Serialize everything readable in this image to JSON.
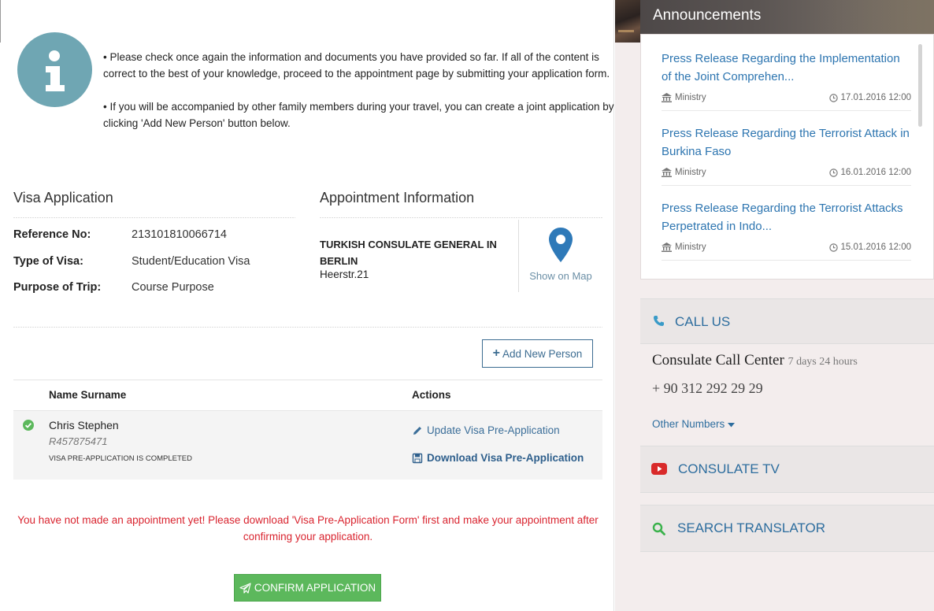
{
  "info": {
    "paragraph1": "• Please check once again the information and documents you have provided so far. If all of the content is correct to the best of your knowledge, proceed to the appointment page by submitting your application form.",
    "paragraph2": "• If you will be accompanied by other family members during your travel, you can create a joint application by clicking 'Add New Person' button below."
  },
  "visa": {
    "title": "Visa Application",
    "reference_label": "Reference No:",
    "reference_value": "213101810066714",
    "type_label": "Type of Visa:",
    "type_value": "Student/Education Visa",
    "purpose_label": "Purpose of Trip:",
    "purpose_value": "Course Purpose"
  },
  "appointment": {
    "title": "Appointment Information",
    "consulate_name": "TURKISH CONSULATE GENERAL IN BERLIN",
    "address": "Heerstr.21",
    "map_label": "Show on Map"
  },
  "add_person_label": "Add New Person",
  "table": {
    "col_name": "Name Surname",
    "col_actions": "Actions",
    "rows": [
      {
        "name": "Chris Stephen",
        "passport": "R457875471",
        "status": "Visa pre-application is completed",
        "update_label": "Update Visa Pre-Application",
        "download_label": "Download Visa Pre-Application"
      }
    ]
  },
  "warning": "You have not made an appointment yet! Please download 'Visa Pre-Application Form' first and make your appointment after confirming your application.",
  "confirm_label": "CONFIRM APPLICATION",
  "sidebar": {
    "announcements_title": "Announcements",
    "announcements": [
      {
        "title": "Press Release Regarding the Implementation of the Joint Comprehen...",
        "source": "Ministry",
        "date": "17.01.2016 12:00"
      },
      {
        "title": "Press Release Regarding the Terrorist Attack in Burkina Faso",
        "source": "Ministry",
        "date": "16.01.2016 12:00"
      },
      {
        "title": "Press Release Regarding the Terrorist Attacks Perpetrated in Indo...",
        "source": "Ministry",
        "date": "15.01.2016 12:00"
      }
    ],
    "call_us": "CALL US",
    "call_center_title": "Consulate Call Center",
    "call_center_hours": "7 days 24 hours",
    "call_number": "+ 90 312 292 29 29",
    "other_numbers": "Other Numbers",
    "consulate_tv": "CONSULATE TV",
    "search_translator": "SEARCH TRANSLATOR"
  },
  "colors": {
    "link": "#2d75b0",
    "confirm": "#5cb85c",
    "warning": "#d9242f",
    "info_circle": "#6fa6b3"
  }
}
